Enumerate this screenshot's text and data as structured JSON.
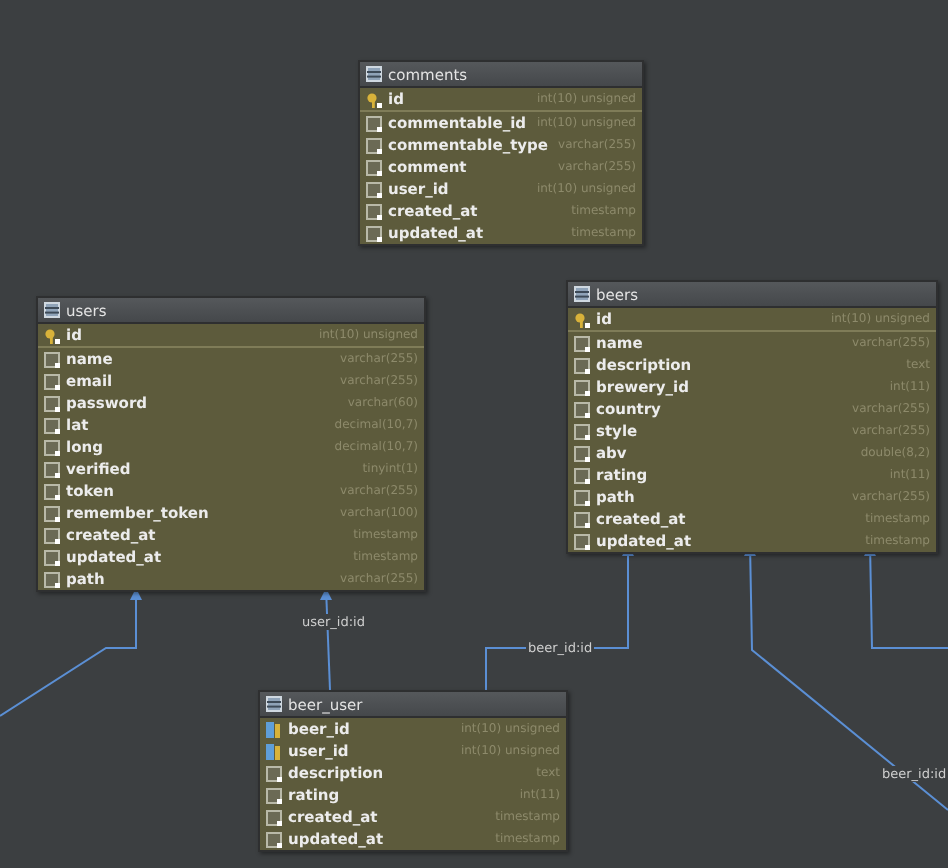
{
  "tables": [
    {
      "name": "comments",
      "columns": [
        {
          "name": "id",
          "type": "int(10) unsigned",
          "kind": "pk"
        },
        {
          "name": "commentable_id",
          "type": "int(10) unsigned",
          "kind": "column"
        },
        {
          "name": "commentable_type",
          "type": "varchar(255)",
          "kind": "column"
        },
        {
          "name": "comment",
          "type": "varchar(255)",
          "kind": "column"
        },
        {
          "name": "user_id",
          "type": "int(10) unsigned",
          "kind": "column"
        },
        {
          "name": "created_at",
          "type": "timestamp",
          "kind": "column"
        },
        {
          "name": "updated_at",
          "type": "timestamp",
          "kind": "column"
        }
      ]
    },
    {
      "name": "users",
      "columns": [
        {
          "name": "id",
          "type": "int(10) unsigned",
          "kind": "pk"
        },
        {
          "name": "name",
          "type": "varchar(255)",
          "kind": "column"
        },
        {
          "name": "email",
          "type": "varchar(255)",
          "kind": "column"
        },
        {
          "name": "password",
          "type": "varchar(60)",
          "kind": "column"
        },
        {
          "name": "lat",
          "type": "decimal(10,7)",
          "kind": "column"
        },
        {
          "name": "long",
          "type": "decimal(10,7)",
          "kind": "column"
        },
        {
          "name": "verified",
          "type": "tinyint(1)",
          "kind": "column"
        },
        {
          "name": "token",
          "type": "varchar(255)",
          "kind": "column"
        },
        {
          "name": "remember_token",
          "type": "varchar(100)",
          "kind": "column"
        },
        {
          "name": "created_at",
          "type": "timestamp",
          "kind": "column"
        },
        {
          "name": "updated_at",
          "type": "timestamp",
          "kind": "column"
        },
        {
          "name": "path",
          "type": "varchar(255)",
          "kind": "column"
        }
      ]
    },
    {
      "name": "beers",
      "columns": [
        {
          "name": "id",
          "type": "int(10) unsigned",
          "kind": "pk"
        },
        {
          "name": "name",
          "type": "varchar(255)",
          "kind": "column"
        },
        {
          "name": "description",
          "type": "text",
          "kind": "column"
        },
        {
          "name": "brewery_id",
          "type": "int(11)",
          "kind": "column"
        },
        {
          "name": "country",
          "type": "varchar(255)",
          "kind": "column"
        },
        {
          "name": "style",
          "type": "varchar(255)",
          "kind": "column"
        },
        {
          "name": "abv",
          "type": "double(8,2)",
          "kind": "column"
        },
        {
          "name": "rating",
          "type": "int(11)",
          "kind": "column"
        },
        {
          "name": "path",
          "type": "varchar(255)",
          "kind": "column"
        },
        {
          "name": "created_at",
          "type": "timestamp",
          "kind": "column"
        },
        {
          "name": "updated_at",
          "type": "timestamp",
          "kind": "column"
        }
      ]
    },
    {
      "name": "beer_user",
      "columns": [
        {
          "name": "beer_id",
          "type": "int(10) unsigned",
          "kind": "fk"
        },
        {
          "name": "user_id",
          "type": "int(10) unsigned",
          "kind": "fk"
        },
        {
          "name": "description",
          "type": "text",
          "kind": "column"
        },
        {
          "name": "rating",
          "type": "int(11)",
          "kind": "column"
        },
        {
          "name": "created_at",
          "type": "timestamp",
          "kind": "column"
        },
        {
          "name": "updated_at",
          "type": "timestamp",
          "kind": "column"
        }
      ]
    }
  ],
  "relations": [
    {
      "label": "user_id:id"
    },
    {
      "label": "beer_id:id"
    },
    {
      "label": "beer_id:id"
    }
  ]
}
